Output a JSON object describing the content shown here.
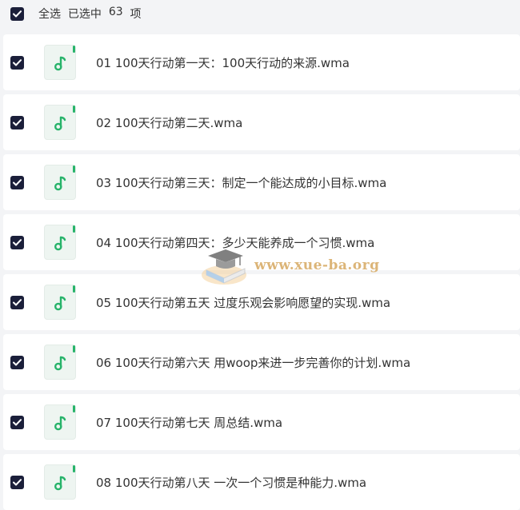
{
  "header": {
    "select_all_label": "全选",
    "selected_prefix": "已选中",
    "selected_count": "63",
    "selected_suffix": "项",
    "select_all_checked": true
  },
  "files": [
    {
      "name": "01 100天行动第一天：100天行动的来源.wma",
      "checked": true
    },
    {
      "name": "02 100天行动第二天.wma",
      "checked": true
    },
    {
      "name": "03 100天行动第三天：制定一个能达成的小目标.wma",
      "checked": true
    },
    {
      "name": "04 100天行动第四天：多少天能养成一个习惯.wma",
      "checked": true
    },
    {
      "name": "05 100天行动第五天 过度乐观会影响愿望的实现.wma",
      "checked": true
    },
    {
      "name": "06 100天行动第六天 用woop来进一步完善你的计划.wma",
      "checked": true
    },
    {
      "name": "07 100天行动第七天 周总结.wma",
      "checked": true
    },
    {
      "name": "08 100天行动第八天 一次一个习惯是种能力.wma",
      "checked": true
    }
  ],
  "file_icon": "music-note-icon",
  "watermark": {
    "text": "www.xue-ba.org",
    "icon": "graduation-cap-book-icon"
  },
  "colors": {
    "checkbox": "#1b1f3a",
    "accent_green": "#27b36a",
    "row_background": "#ffffff",
    "page_background": "#f3f4f6"
  }
}
